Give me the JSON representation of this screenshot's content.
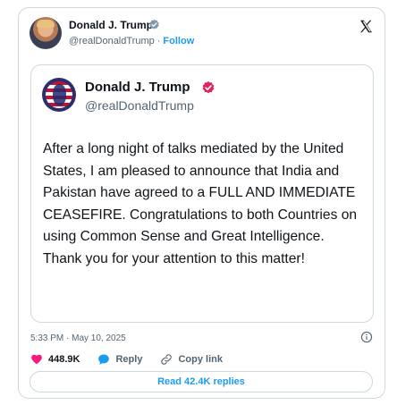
{
  "header": {
    "author_name": "Donald J. Trump",
    "handle": "@realDonaldTrump",
    "separator": "·",
    "follow_label": "Follow"
  },
  "embedded_post": {
    "author_name": "Donald J. Trump",
    "handle": "@realDonaldTrump",
    "text": "After a long night of talks mediated by the United States, I am pleased to announce that India and Pakistan have agreed to a FULL AND IMMEDIATE CEASEFIRE. Congratulations to both Countries on using Common Sense and Great Intelligence. Thank you for your attention to this matter!"
  },
  "timestamp": "5:33 PM · May 10, 2025",
  "actions": {
    "likes": "448.9K",
    "reply_label": "Reply",
    "copy_link_label": "Copy link"
  },
  "read_replies_label": "Read 42.4K replies",
  "icons": {
    "avatar": "profile-photo",
    "verified_gray": "gray-verified-badge",
    "verified_red": "red-verified-badge",
    "x_logo": "x-logo",
    "info": "info-icon",
    "like": "heart-icon",
    "reply": "reply-bubble-icon",
    "copy": "link-icon"
  },
  "colors": {
    "accent": "#1d9bf0",
    "like": "#f91880",
    "verified_red": "#e0245e",
    "verified_gray": "#829aab",
    "muted_text": "#536471",
    "border": "#cfd9de"
  }
}
